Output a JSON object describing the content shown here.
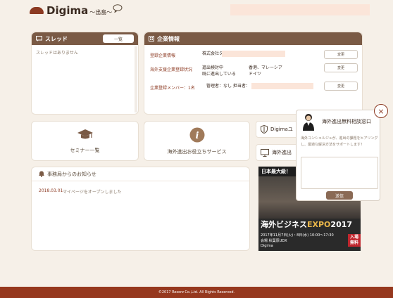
{
  "header": {
    "logo_text": "Digima",
    "logo_sub": "～出島～"
  },
  "thread": {
    "title": "スレッド",
    "all_label": "一覧",
    "empty_text": "スレッドはありません"
  },
  "company": {
    "title": "企業情報",
    "rows": [
      {
        "label": "登録企業情報",
        "value": "株式会社タ",
        "button": "変更"
      },
      {
        "label": "海外支援企業登録状況",
        "value_line1": "進出検討中",
        "value_line2": "既に進出している",
        "countries_line1": "香港、マレーシア",
        "countries_line2": "ドイツ",
        "button": "変更"
      },
      {
        "label": "企業登録メンバー：1名",
        "value": "管理者：なし 担当者：",
        "button": "変更"
      }
    ]
  },
  "tiles": {
    "seminar": "セミナー一覧",
    "useful": "海外進出お役立ちサービス"
  },
  "side_buttons": [
    {
      "label": "Digimaユ"
    },
    {
      "label": "海外進出"
    }
  ],
  "news": {
    "title": "事務局からのお知らせ",
    "items": [
      {
        "date": "2018.03.01",
        "text": "マイページをオープンしました"
      }
    ]
  },
  "expo": {
    "top_label": "日本最大級！",
    "title_main": "海外ビジネス",
    "title_expo": "EXPO",
    "title_year": "2017",
    "date": "2017年11月7日(火)・8日(水) 10:00〜17:30",
    "venue": "会場 秋葉原UDX",
    "brand": "Digima",
    "free_line1": "入場",
    "free_line2": "無料"
  },
  "consult": {
    "title": "海外進出無料相談窓口",
    "description": "海外コンシェルジュが、進出の課題をヒアリングし、最適な解決方法をサポートします！",
    "send_label": "送信",
    "close_label": "×"
  },
  "footer": {
    "copyright": "©2017 Resorz Co.,Ltd. All Rights Reserved."
  },
  "colors": {
    "brand": "#8c3a22",
    "footer": "#96381e",
    "card_head": "#7a5a45",
    "background": "#f6f0e8"
  }
}
